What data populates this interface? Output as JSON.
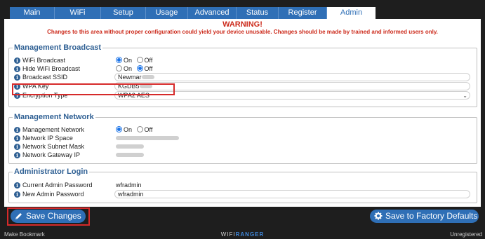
{
  "tabs": [
    {
      "label": "Main",
      "active": false
    },
    {
      "label": "WiFi",
      "active": false
    },
    {
      "label": "Setup",
      "active": false
    },
    {
      "label": "Usage",
      "active": false
    },
    {
      "label": "Advanced",
      "active": false
    },
    {
      "label": "Status",
      "active": false
    },
    {
      "label": "Register",
      "active": false
    },
    {
      "label": "Admin",
      "active": true
    }
  ],
  "warning": {
    "title": "WARNING!",
    "text": "Changes to this area without proper configuration could yield your device unusable. Changes should be made by trained and informed users only."
  },
  "broadcast": {
    "legend": "Management Broadcast",
    "wifi_broadcast": {
      "label": "WiFi Broadcast",
      "on": "On",
      "off": "Off",
      "selected": "On"
    },
    "hide_broadcast": {
      "label": "Hide WiFi Broadcast",
      "on": "On",
      "off": "Off",
      "selected": "Off"
    },
    "ssid": {
      "label": "Broadcast SSID",
      "value": "Newmar"
    },
    "wpa_key": {
      "label": "WPA Key",
      "value": "KGDB5"
    },
    "encryption": {
      "label": "Encryption Type",
      "value": "WPA2 AES"
    }
  },
  "network": {
    "legend": "Management Network",
    "management": {
      "label": "Management Network",
      "on": "On",
      "off": "Off",
      "selected": "On"
    },
    "ip_space": {
      "label": "Network IP Space"
    },
    "subnet": {
      "label": "Network Subnet Mask"
    },
    "gateway": {
      "label": "Network Gateway IP"
    }
  },
  "admin": {
    "legend": "Administrator Login",
    "current": {
      "label": "Current Admin Password",
      "value": "wfradmin"
    },
    "new": {
      "label": "New Admin Password",
      "value": "wfradmin"
    }
  },
  "buttons": {
    "save": "Save Changes",
    "factory": "Save to Factory Defaults"
  },
  "footer": {
    "left": "Make Bookmark",
    "brand_light": "WIFI",
    "brand_bold": "RANGER",
    "right": "Unregistered"
  },
  "colors": {
    "accent": "#2f6fb6",
    "warning": "#cc2a1b",
    "legend": "#2e5f93",
    "highlight": "#d62a2a"
  }
}
